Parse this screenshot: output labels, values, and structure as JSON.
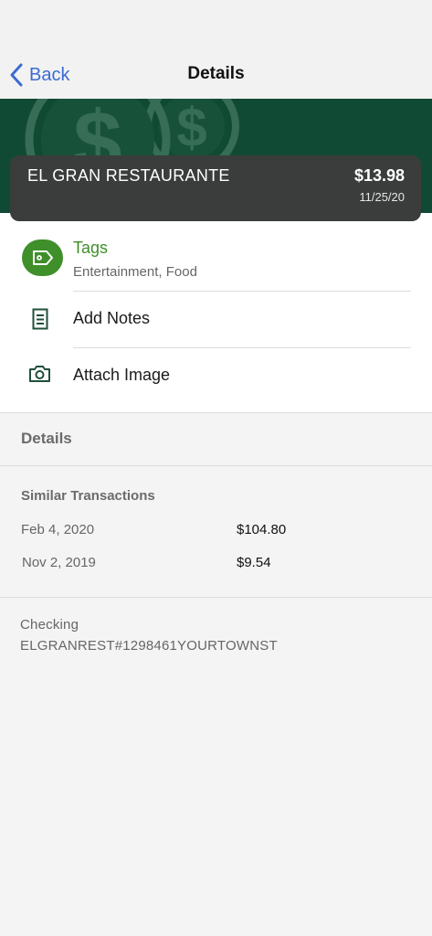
{
  "nav": {
    "back_label": "Back",
    "title": "Details"
  },
  "transaction": {
    "merchant": "EL GRAN RESTAURANTE",
    "amount": "$13.98",
    "date": "11/25/20"
  },
  "actions": {
    "tags_label": "Tags",
    "tags_value": "Entertainment, Food",
    "notes_label": "Add Notes",
    "image_label": "Attach Image"
  },
  "details": {
    "section_title": "Details",
    "similar_title": "Similar Transactions",
    "similar": [
      {
        "date": "Feb 4, 2020",
        "amount": "$104.80"
      },
      {
        "date": "Nov 2, 2019",
        "amount": "$9.54"
      }
    ],
    "account": "Checking",
    "description": "ELGRANREST#1298461YOURTOWNST"
  },
  "colors": {
    "accent_blue": "#3b6bd1",
    "brand_green": "#114a34",
    "tag_green": "#3f8f2a",
    "card_bg": "#3a3d3c"
  },
  "icons": [
    "chevron-left-icon",
    "dollar-coin-icon",
    "tag-icon",
    "notes-icon",
    "camera-icon"
  ]
}
